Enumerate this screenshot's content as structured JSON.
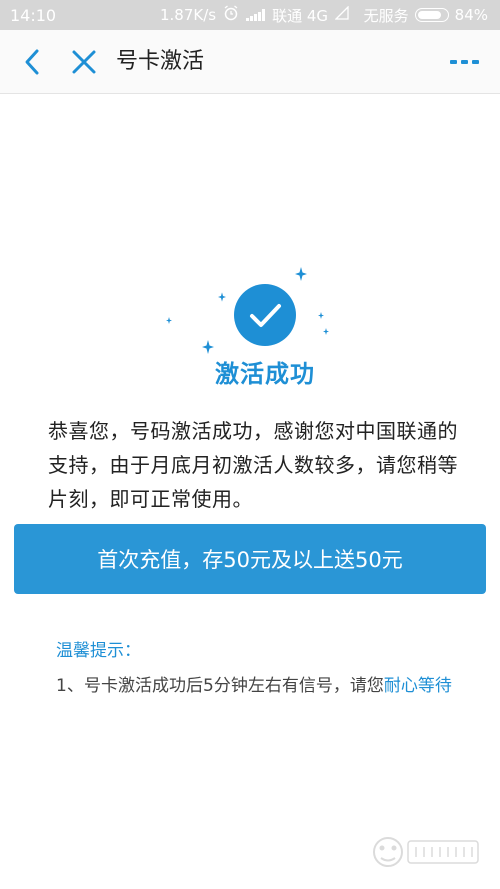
{
  "status_bar": {
    "time": "14:10",
    "speed": "1.87K/s",
    "carrier": "联通 4G",
    "no_service": "无服务",
    "battery": "84%",
    "battery_level": 0.84
  },
  "nav": {
    "title": "号卡激活"
  },
  "success": {
    "title": "激活成功",
    "message": "恭喜您，号码激活成功，感谢您对中国联通的支持，由于月底月初激活人数较多，请您稍等片刻，即可正常使用。"
  },
  "recharge_button": {
    "label": "首次充值，存50元及以上送50元"
  },
  "tips": {
    "title": "温馨提示：",
    "items": [
      {
        "number": "1、",
        "text": "号卡激活成功后5分钟左右有信号，请您",
        "link": "耐心等待"
      }
    ]
  },
  "colors": {
    "accent": "#1e8fd5",
    "button": "#2a96d6",
    "status_bar": "#d6d6d6"
  }
}
